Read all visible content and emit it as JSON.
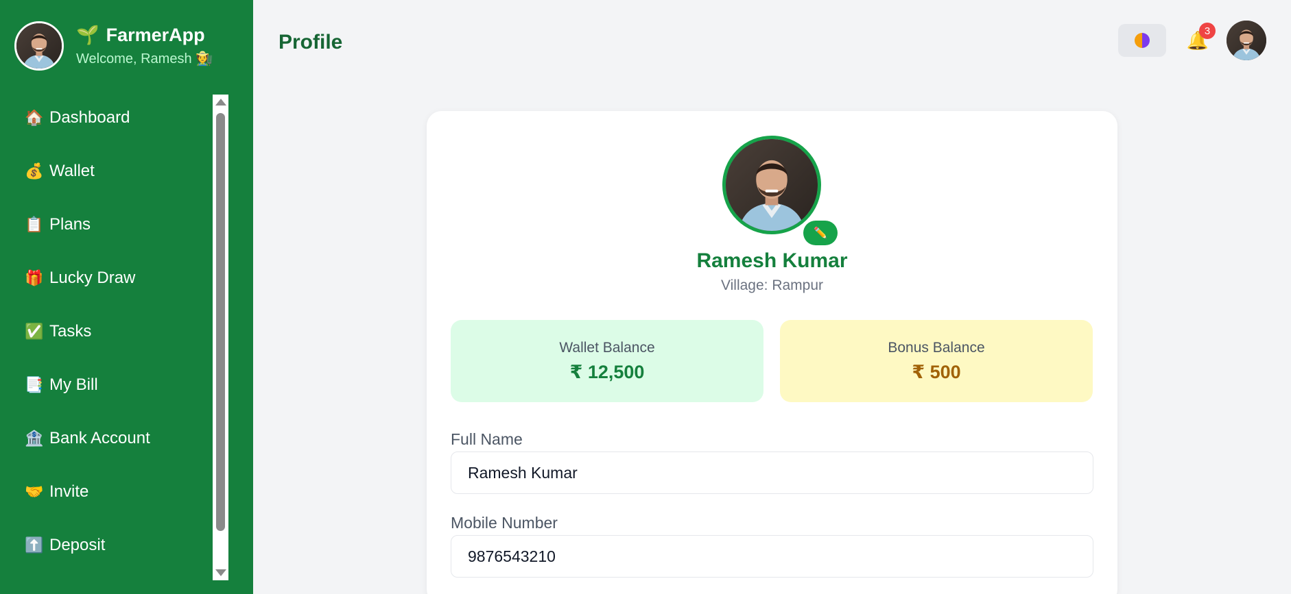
{
  "sidebar": {
    "brand_title": "FarmerApp",
    "brand_icon": "🌱",
    "welcome": "Welcome, Ramesh 🧑‍🌾",
    "items": [
      {
        "icon": "🏠",
        "label": "Dashboard"
      },
      {
        "icon": "💰",
        "label": "Wallet"
      },
      {
        "icon": "📋",
        "label": "Plans"
      },
      {
        "icon": "🎁",
        "label": "Lucky Draw"
      },
      {
        "icon": "✅",
        "label": "Tasks"
      },
      {
        "icon": "📑",
        "label": "My Bill"
      },
      {
        "icon": "🏦",
        "label": "Bank Account"
      },
      {
        "icon": "🤝",
        "label": "Invite"
      },
      {
        "icon": "⬆️",
        "label": "Deposit"
      }
    ]
  },
  "header": {
    "title": "Profile",
    "notification_count": "3",
    "bell_icon": "🔔"
  },
  "profile": {
    "name": "Ramesh Kumar",
    "village": "Village: Rampur",
    "edit_icon": "✏️",
    "wallet_label": "Wallet Balance",
    "wallet_value": "₹ 12,500",
    "bonus_label": "Bonus Balance",
    "bonus_value": "₹ 500"
  },
  "form": {
    "full_name_label": "Full Name",
    "full_name_value": "Ramesh Kumar",
    "mobile_label": "Mobile Number",
    "mobile_value": "9876543210"
  },
  "colors": {
    "sidebar": "#15803d",
    "accent": "#16a34a",
    "wallet_bg": "#dcfce7",
    "bonus_bg": "#fef9c3"
  }
}
